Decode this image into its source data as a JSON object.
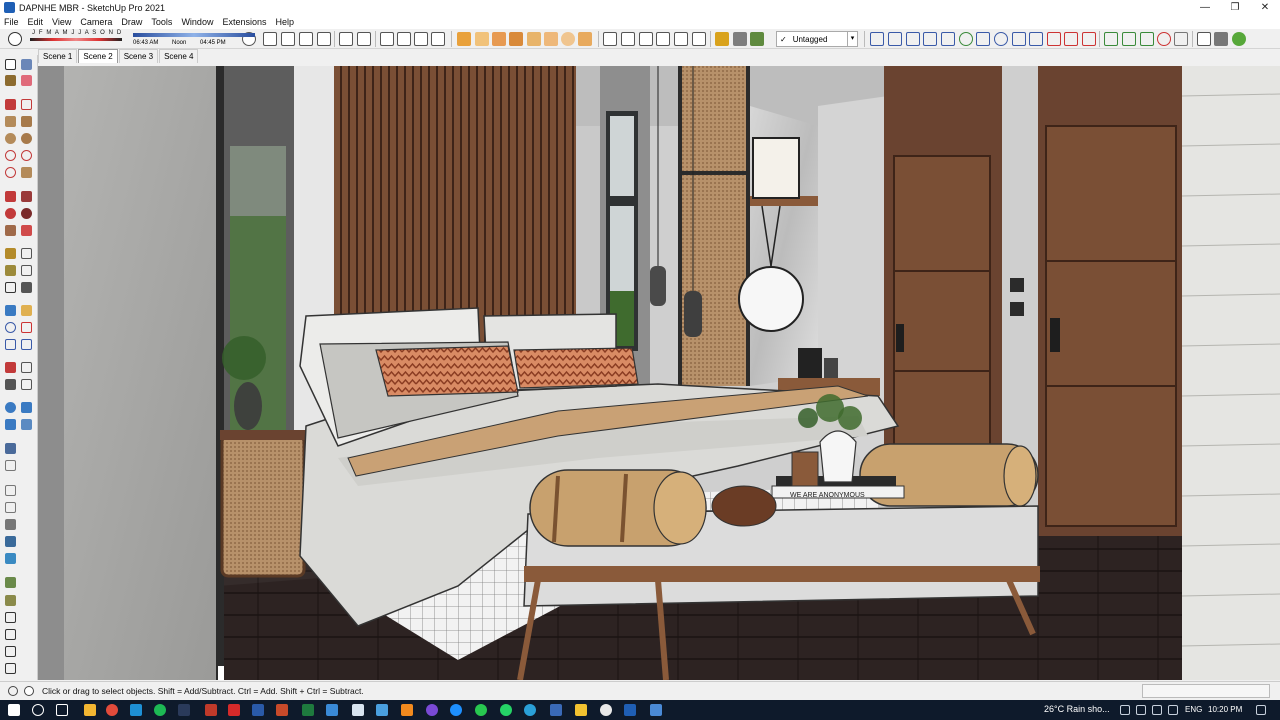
{
  "window": {
    "title": "DAPNHE MBR - SketchUp Pro 2021",
    "controls": {
      "minimize": "—",
      "maximize": "❐",
      "close": "✕"
    }
  },
  "menu": [
    "File",
    "Edit",
    "View",
    "Camera",
    "Draw",
    "Tools",
    "Window",
    "Extensions",
    "Help"
  ],
  "shadow_widget": {
    "months": "J F M A M J J A S O N D",
    "time_start": "06:43 AM",
    "time_mid": "Noon",
    "time_end": "04:45 PM"
  },
  "tag_selector": {
    "check": "✓",
    "value": "Untagged",
    "caret": "▾"
  },
  "scenes": [
    {
      "label": "Scene 1",
      "active": false
    },
    {
      "label": "Scene 2",
      "active": true
    },
    {
      "label": "Scene 3",
      "active": false
    },
    {
      "label": "Scene 4",
      "active": false
    }
  ],
  "viewport": {
    "book_spine_text": "WE ARE ANONYMOUS"
  },
  "status": {
    "message": "Click or drag to select objects. Shift = Add/Subtract. Ctrl = Add. Shift + Ctrl = Subtract."
  },
  "taskbar": {
    "weather": "26°C  Rain sho...",
    "language": "ENG",
    "time": "10:20 PM"
  },
  "colors": {
    "accent": "#1f5fb5",
    "wood": "#7a4f35",
    "floor": "#2d2322",
    "wall_concrete": "#a9a9a9"
  }
}
